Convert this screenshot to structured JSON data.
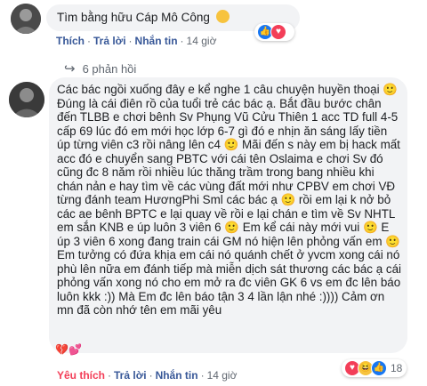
{
  "top_comment": {
    "author": "",
    "text": "Tìm bằng hữu Cáp Mô Công",
    "emoji": "grinning-sweat",
    "actions": {
      "like": "Thích",
      "reply": "Trả lời",
      "message": "Nhắn tin",
      "time": "14 giờ"
    },
    "reactions": {
      "types": [
        "like",
        "love"
      ],
      "count": ""
    }
  },
  "replies_link": "6 phản hồi",
  "main_comment": {
    "author": "",
    "paragraphs": [
      "Các bác ngồi xuống đây e kể nghe 1 câu chuyện huyền thoại 🙂",
      "Đúng là cái điên rồ của tuổi trẻ các bác ạ. Bắt đầu bước chân đến TLBB e chơi bênh Sv Phụng Vũ Cửu Thiên 1 acc TD full 4-5 cấp 69 lúc đó em mới học lớp 6-7 gì đó e nhịn ăn sáng lấy tiền úp từng viên c3 rồi nâng lên c4 🙂 Mãi đến s này em bị hack mất acc đó e chuyển sang PBTC với cái tên Oslaima e chơi Sv đó cũng đc 8 năm rồi nhiều lúc thăng trầm trong bang nhiều khi chán nản e hay tìm về các vùng đất mới như CPBV em chơi VĐ từng đánh team HươngPhi Sml các bác ạ 🙂 rồi em lại k nở bỏ các ae bênh BPTC e lại quay về rồi e lại chán e tìm về Sv NHTL em sắn KNB e úp luôn 3 viên 6 🙂 Em kể cái này mới vui 🙂 E úp 3 viên 6 xong đang train cái GM nó hiện lên phỏng vấn em 🙂 Em tưởng có đứa khịa em cái nó quánh chết ở yvcm xong cái nó phù lên nữa em đánh tiếp mà miễn dịch sát thương các bác ạ cái phỏng vấn xong nó cho em mở ra đc viên GK 6 vs em đc lên báo luôn kkk :)) Mà Em đc lên báo tận 3 4 lần lận nhé :)))) Cảm ơn mn đã còn nhớ tên em mãi yêu",
      "💔💕"
    ],
    "actions": {
      "like": "Yêu thích",
      "reply": "Trả lời",
      "message": "Nhắn tin",
      "time": "14 giờ"
    },
    "reactions": {
      "types": [
        "love",
        "haha",
        "like"
      ],
      "count": "18"
    }
  }
}
